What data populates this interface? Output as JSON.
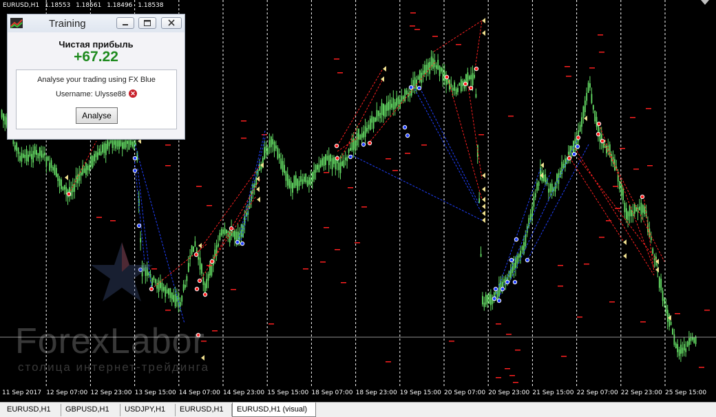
{
  "chart": {
    "symbol": "EURUSD,H1",
    "open": "1.18553",
    "high": "1.18561",
    "low": "1.18496",
    "close": "1.18538",
    "time_labels": [
      "11 Sep 2017",
      "12 Sep 07:00",
      "12 Sep 23:00",
      "13 Sep 15:00",
      "14 Sep 07:00",
      "14 Sep 23:00",
      "15 Sep 15:00",
      "18 Sep 07:00",
      "18 Sep 23:00",
      "19 Sep 15:00",
      "20 Sep 07:00",
      "20 Sep 23:00",
      "21 Sep 15:00",
      "22 Sep 07:00",
      "22 Sep 23:00",
      "25 Sep 15:00"
    ],
    "colors": {
      "background": "#000000",
      "candle": "#66e066",
      "sell": "#ff2020",
      "buy": "#2040ff",
      "grid": "#ffffff",
      "arrow": "#f0e090"
    }
  },
  "watermark": {
    "title": "ForexLabor",
    "subtitle": "столица интернет-трейдинга"
  },
  "dialog": {
    "title": "Training",
    "profit_label": "Чистая прибыль",
    "profit_value": "+67.22",
    "analyse_text": "Analyse your trading using FX Blue",
    "username_text": "Username: Ulysse88",
    "analyse_button": "Analyse",
    "buttons": {
      "minimize": "minimize-icon",
      "maximize": "maximize-icon",
      "close": "close-icon"
    }
  },
  "tabs": [
    {
      "label": "EURUSD,H1",
      "active": false
    },
    {
      "label": "GBPUSD,H1",
      "active": false
    },
    {
      "label": "USDJPY,H1",
      "active": false
    },
    {
      "label": "EURUSD,H1",
      "active": false
    },
    {
      "label": "EURUSD,H1 (visual)",
      "active": true
    }
  ]
}
